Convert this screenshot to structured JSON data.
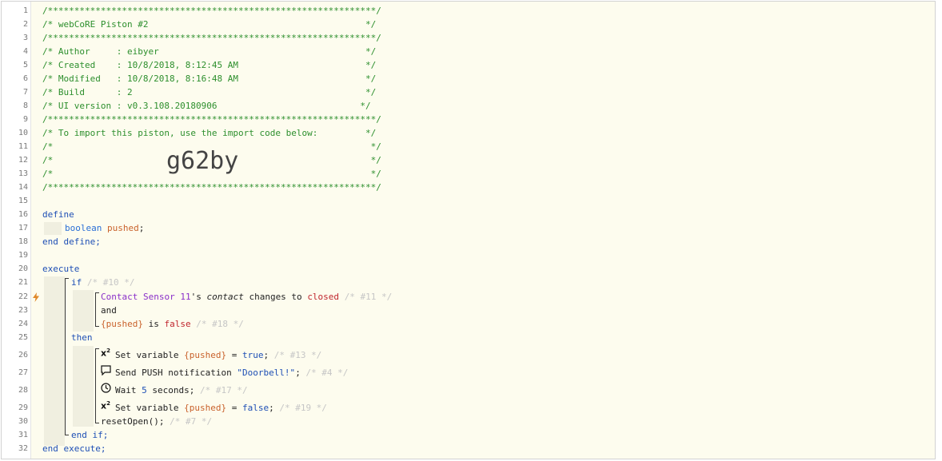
{
  "line_numbers": [
    "1",
    "2",
    "3",
    "4",
    "5",
    "6",
    "7",
    "8",
    "9",
    "10",
    "11",
    "12",
    "13",
    "14",
    "15",
    "16",
    "17",
    "18",
    "19",
    "20",
    "21",
    "22",
    "23",
    "24",
    "25",
    "26",
    "27",
    "28",
    "29",
    "30",
    "31",
    "32"
  ],
  "header": {
    "stars": "/**************************************************************/",
    "title": "/* webCoRE Piston #2                                         */",
    "author": "/* Author     : eibyer                                       */",
    "created": "/* Created    : 10/8/2018, 8:12:45 AM                        */",
    "modified": "/* Modified   : 10/8/2018, 8:16:48 AM                        */",
    "build": "/* Build      : 2                                            */",
    "ui_version": "/* UI version : v0.3.108.20180906                           */",
    "import_note": "/* To import this piston, use the import code below:         */",
    "blank": "/*                                                            */",
    "import_code": "g62by"
  },
  "code": {
    "define": "define",
    "boolean": "boolean",
    "pushed_decl": "pushed",
    "semicolon": ";",
    "end_define": "end define;",
    "execute": "execute",
    "if_kw": "if",
    "if_comment": "/* #10 */",
    "device": "Contact Sensor 11",
    "possessive": "'s ",
    "attribute": "contact",
    "changes_to": " changes to ",
    "closed": "closed",
    "cond1_comment": "/* #11 */",
    "and": "and",
    "pushed_ref": "{pushed}",
    "is": " is ",
    "false": "false",
    "cond2_comment": "/* #18 */",
    "then": "then",
    "set_variable": "Set variable ",
    "eq": " = ",
    "true": "true",
    "stmt1_comment": "/* #13 */",
    "send_push": "Send PUSH notification ",
    "message": "\"Doorbell!\"",
    "stmt2_comment": "/* #4 */",
    "wait": "Wait ",
    "five": "5",
    "seconds": " seconds;",
    "stmt3_comment": "/* #17 */",
    "stmt4_comment": "/* #19 */",
    "reset": "resetOpen();",
    "stmt5_comment": "/* #7 */",
    "end_if": "end if;",
    "end_execute": "end execute;"
  },
  "icons": [
    "lightning-bolt-icon",
    "variable-x-squared-icon",
    "speech-bubble-icon",
    "clock-icon"
  ]
}
